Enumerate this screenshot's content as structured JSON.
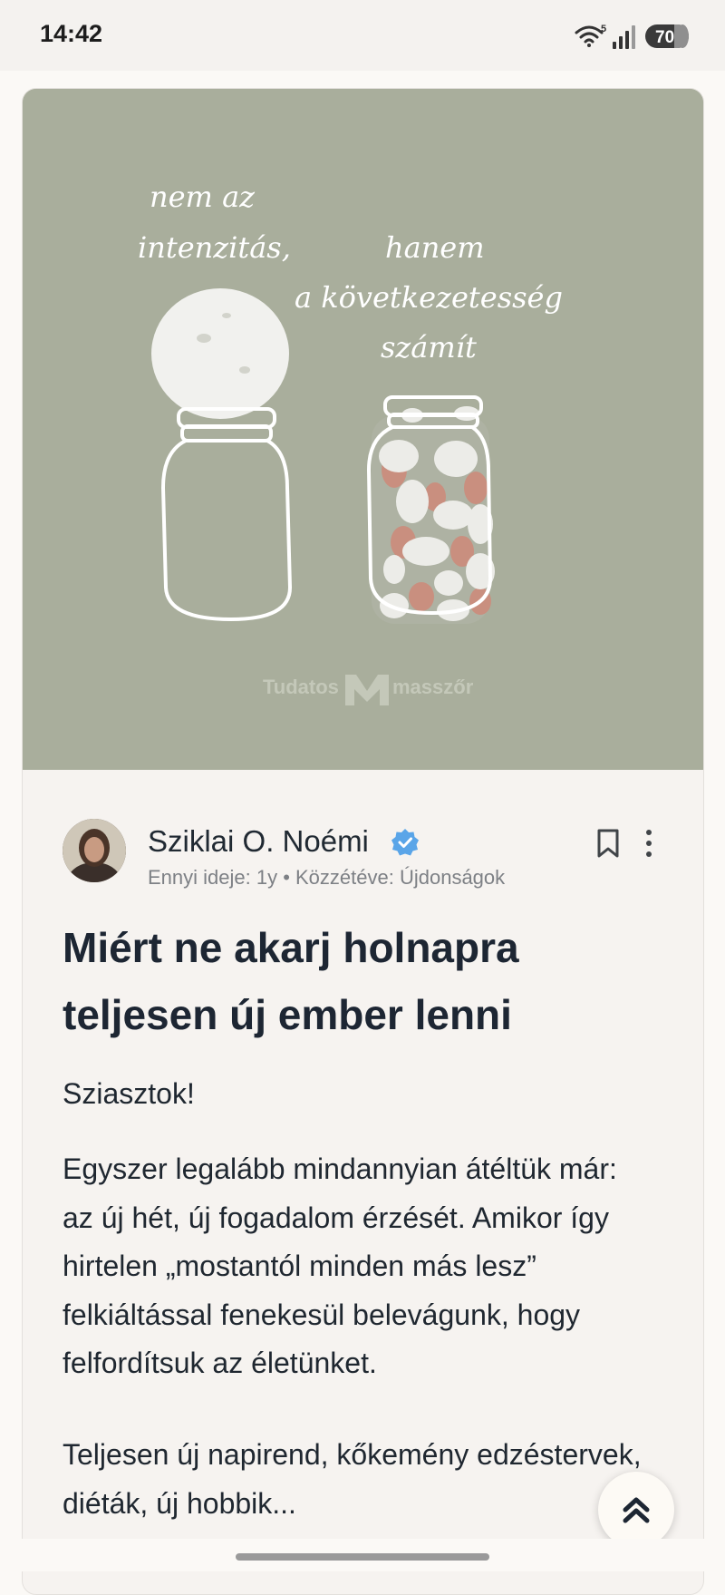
{
  "status_bar": {
    "time": "14:42",
    "battery": "70",
    "wifi_badge": "5"
  },
  "hero": {
    "lines": [
      "nem az",
      "intenzitás,",
      "hanem",
      "a következetesség",
      "számít"
    ],
    "watermark_left": "Tudatos",
    "watermark_right": "masszőr",
    "colors": {
      "background": "#a9ae9c",
      "ink": "#ffffff",
      "accent": "#c98f7f"
    }
  },
  "author": {
    "name": "Sziklai O. Noémi",
    "meta": "Ennyi ideje: 1y • Közzétéve: Újdonságok",
    "verified_color": "#5aa5e8"
  },
  "article": {
    "title": "Miért ne akarj holnapra teljesen új ember lenni",
    "greeting": "Sziasztok!",
    "paragraph1": "Egyszer legalább mindannyian átéltük már: az új hét, új fogadalom érzését. Amikor így hirtelen „mostantól minden más lesz” felkiáltással fenekesül belevágunk, hogy felfordítsuk az életünket.",
    "paragraph2": "Teljesen új napirend, kőkemény edzéstervek, diéták, új hobbik..."
  },
  "icons": {
    "bookmark": "bookmark-icon",
    "more": "more-vertical-icon",
    "scroll_top": "double-chevron-up-icon"
  }
}
